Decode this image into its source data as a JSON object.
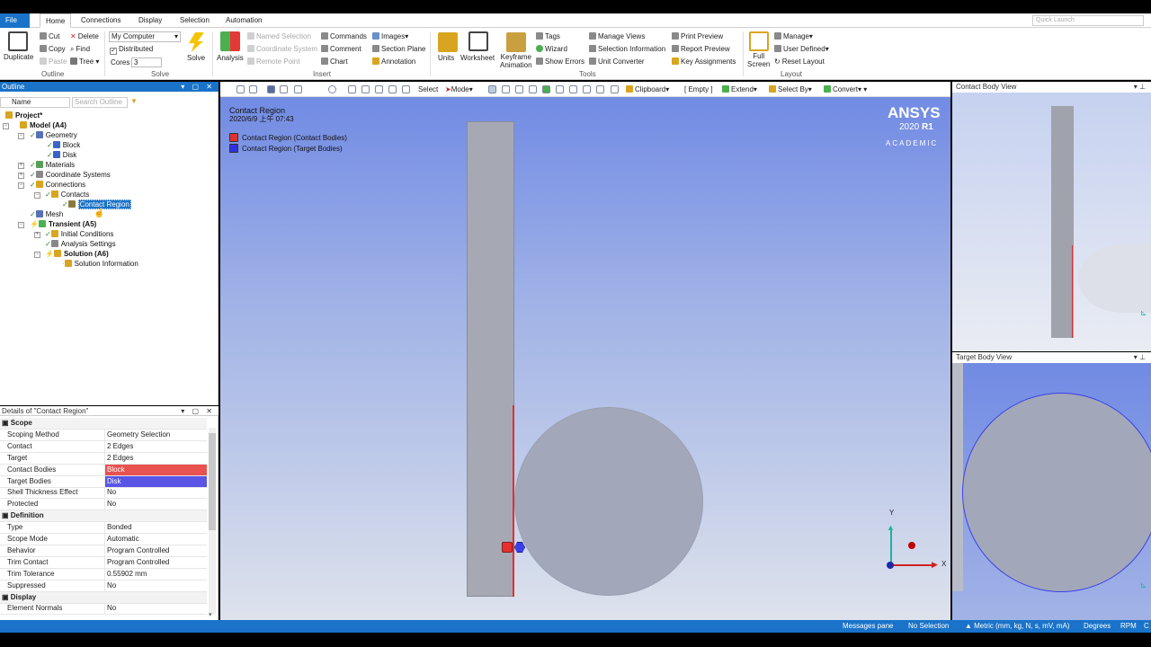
{
  "tabs": [
    "File",
    "Home",
    "Connections",
    "Display",
    "Selection",
    "Automation"
  ],
  "quick_launch_placeholder": "Quick Launch",
  "ribbon": {
    "outline": {
      "duplicate": "Duplicate",
      "cut": "Cut",
      "copy": "Copy",
      "paste": "Paste",
      "delete": "Delete",
      "find": "Find",
      "tree": "Tree",
      "group": "Outline"
    },
    "solve": {
      "computer": "My Computer",
      "distributed": "Distributed",
      "cores_label": "Cores",
      "cores_value": "3",
      "solve": "Solve",
      "group": "Solve"
    },
    "insert": {
      "analysis": "Analysis",
      "named_selection": "Named Selection",
      "coordinate_system": "Coordinate System",
      "remote_point": "Remote Point",
      "commands": "Commands",
      "comment": "Comment",
      "chart": "Chart",
      "images": "Images",
      "section_plane": "Section Plane",
      "annotation": "Annotation",
      "group": "Insert"
    },
    "tools": {
      "units": "Units",
      "worksheet": "Worksheet",
      "keyframe1": "Keyframe",
      "keyframe2": "Animation",
      "tags": "Tags",
      "wizard": "Wizard",
      "show_errors": "Show Errors",
      "manage_views": "Manage Views",
      "selection_information": "Selection Information",
      "unit_converter": "Unit Converter",
      "print_preview": "Print Preview",
      "report_preview": "Report Preview",
      "key_assignments": "Key Assignments",
      "group": "Tools"
    },
    "layout": {
      "full1": "Full",
      "full2": "Screen",
      "manage": "Manage",
      "user_defined": "User Defined",
      "reset_layout": "Reset Layout",
      "group": "Layout"
    }
  },
  "outline": {
    "title": "Outline",
    "name_col": "Name",
    "search_placeholder": "Search Outline",
    "tree": {
      "project": "Project*",
      "model": "Model (A4)",
      "geometry": "Geometry",
      "block": "Block",
      "disk": "Disk",
      "materials": "Materials",
      "coordinate_systems": "Coordinate Systems",
      "connections": "Connections",
      "contacts": "Contacts",
      "contact_region": "Contact Region",
      "mesh": "Mesh",
      "transient": "Transient (A5)",
      "initial_conditions": "Initial Conditions",
      "analysis_settings": "Analysis Settings",
      "solution": "Solution (A6)",
      "solution_information": "Solution Information"
    }
  },
  "details": {
    "title": "Details of \"Contact Region\"",
    "rows": [
      {
        "k": "Scope",
        "v": "",
        "section": true
      },
      {
        "k": "Scoping Method",
        "v": "Geometry Selection"
      },
      {
        "k": "Contact",
        "v": "2 Edges"
      },
      {
        "k": "Target",
        "v": "2 Edges"
      },
      {
        "k": "Contact Bodies",
        "v": "Block",
        "color": "#e8524f"
      },
      {
        "k": "Target Bodies",
        "v": "Disk",
        "color": "#5a55e6"
      },
      {
        "k": "Shell Thickness Effect",
        "v": "No"
      },
      {
        "k": "Protected",
        "v": "No"
      },
      {
        "k": "Definition",
        "v": "",
        "section": true
      },
      {
        "k": "Type",
        "v": "Bonded"
      },
      {
        "k": "Scope Mode",
        "v": "Automatic"
      },
      {
        "k": "Behavior",
        "v": "Program Controlled"
      },
      {
        "k": "Trim Contact",
        "v": "Program Controlled"
      },
      {
        "k": "Trim Tolerance",
        "v": "0.55902 mm"
      },
      {
        "k": "Suppressed",
        "v": "No"
      },
      {
        "k": "Display",
        "v": "",
        "section": true
      },
      {
        "k": "Element Normals",
        "v": "No"
      }
    ]
  },
  "viewport_toolbar": {
    "select": "Select",
    "mode": "Mode",
    "clipboard": "Clipboard",
    "empty": "[ Empty ]",
    "extend": "Extend",
    "select_by": "Select By",
    "convert": "Convert"
  },
  "viewport": {
    "title": "Contact Region",
    "timestamp": "2020/6/9 上午 07:43",
    "legend": [
      {
        "label": "Contact Region (Contact Bodies)",
        "color": "#e03030"
      },
      {
        "label": "Contact Region (Target Bodies)",
        "color": "#3030e0"
      }
    ],
    "brand": "ANSYS",
    "version_prefix": "2020",
    "version_suffix": "R1",
    "academic": "ACADEMIC",
    "triad": {
      "y": "Y",
      "x": "X"
    }
  },
  "contact_body_view": "Contact Body View",
  "target_body_view": "Target Body View",
  "status": {
    "messages": "Messages pane",
    "selection": "No Selection",
    "units": "Metric (mm, kg, N, s, mV, mA)",
    "degrees": "Degrees",
    "rpm": "RPM",
    "last": "C"
  }
}
